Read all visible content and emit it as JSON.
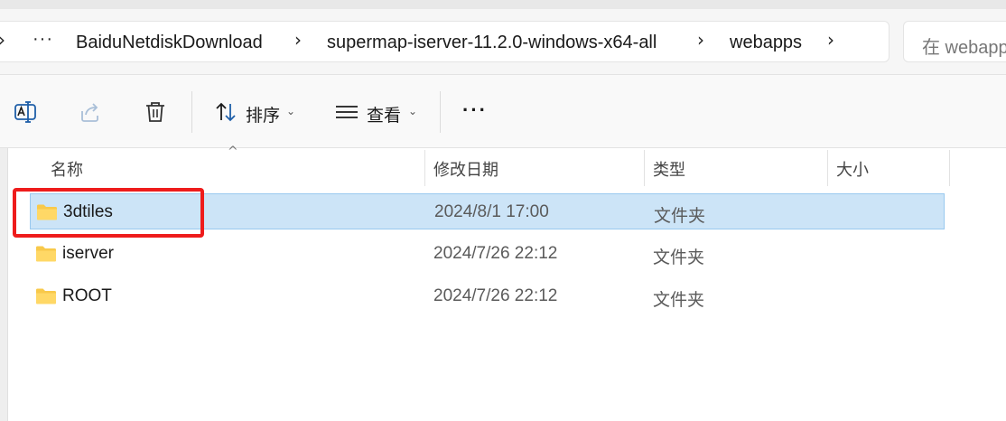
{
  "breadcrumb": {
    "more_label": "···",
    "items": [
      {
        "label": "BaiduNetdiskDownload"
      },
      {
        "label": "supermap-iserver-11.2.0-windows-x64-all"
      },
      {
        "label": "webapps"
      }
    ]
  },
  "search": {
    "placeholder": "在 webapps"
  },
  "toolbar": {
    "sort_label": "排序",
    "view_label": "查看",
    "more_label": "···"
  },
  "columns": {
    "name": "名称",
    "modified": "修改日期",
    "type": "类型",
    "size": "大小"
  },
  "files": [
    {
      "name": "3dtiles",
      "modified": "2024/8/1 17:00",
      "type": "文件夹",
      "selected": true
    },
    {
      "name": "iserver",
      "modified": "2024/7/26 22:12",
      "type": "文件夹",
      "selected": false
    },
    {
      "name": "ROOT",
      "modified": "2024/7/26 22:12",
      "type": "文件夹",
      "selected": false
    }
  ],
  "colors": {
    "selection": "#cce4f7",
    "selection_border": "#99c9ef",
    "annotation": "#ee1c1c",
    "folder": "#f8c94a"
  },
  "icons": {
    "toolbar": [
      "rename-icon",
      "share-icon",
      "delete-icon",
      "sort-icon",
      "view-icon",
      "more-icon"
    ],
    "row": "folder-icon"
  }
}
